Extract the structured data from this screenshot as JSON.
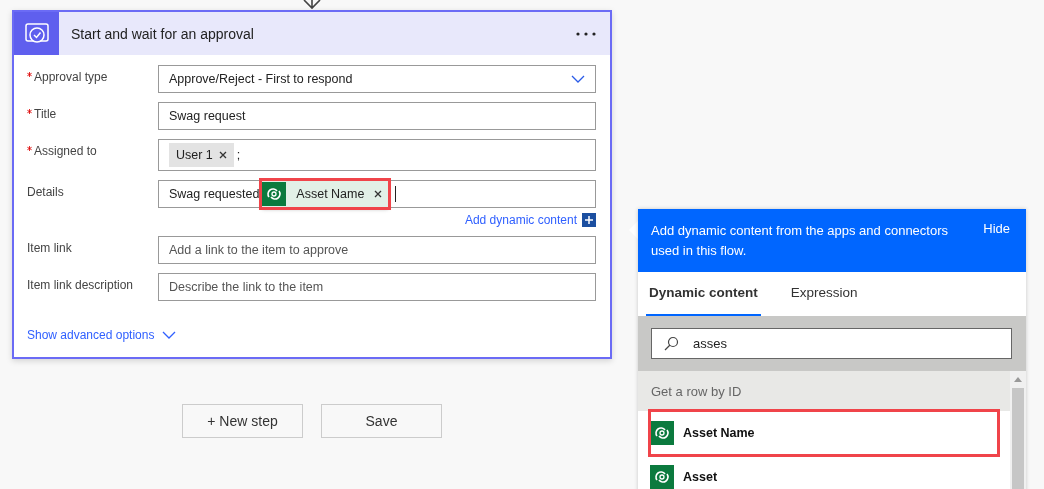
{
  "action_card": {
    "title": "Start and wait for an approval",
    "fields": [
      {
        "label": "Approval type",
        "required": true,
        "kind": "dropdown",
        "parts": [
          {
            "kind": "text",
            "text": "Approve/Reject - First to respond"
          }
        ]
      },
      {
        "label": "Title",
        "required": true,
        "kind": "text",
        "parts": [
          {
            "kind": "text",
            "text": "Swag request"
          }
        ]
      },
      {
        "label": "Assigned to",
        "required": true,
        "kind": "tokens",
        "parts": [
          {
            "kind": "person",
            "text": "User 1"
          },
          {
            "kind": "text",
            "text": ";"
          }
        ]
      },
      {
        "label": "Details",
        "required": false,
        "kind": "tokens",
        "dynamic_link": "Add dynamic content",
        "parts": [
          {
            "kind": "text",
            "text": "Swag requested"
          },
          {
            "kind": "dynamic",
            "text": "Asset Name",
            "highlighted": true
          }
        ]
      },
      {
        "label": "Item link",
        "required": false,
        "kind": "text",
        "placeholder": "Add a link to the item to approve"
      },
      {
        "label": "Item link description",
        "required": false,
        "kind": "text",
        "placeholder": "Describe the link to the item"
      }
    ],
    "advanced": {
      "label": "Show advanced options",
      "expanded": false
    }
  },
  "buttons": [
    {
      "label": "+ New step"
    },
    {
      "label": "Save"
    }
  ],
  "dynamic_panel": {
    "message": "Add dynamic content from the apps and connectors used in this flow.",
    "hide": "Hide",
    "tabs": [
      {
        "label": "Dynamic content",
        "selected": true
      },
      {
        "label": "Expression",
        "selected": false
      }
    ],
    "search": {
      "value": "asses"
    },
    "groups": [
      {
        "title": "Get a row by ID",
        "items": [
          {
            "name": "Asset Name",
            "highlighted": true
          },
          {
            "name": "Asset",
            "highlighted": false
          }
        ]
      }
    ]
  }
}
